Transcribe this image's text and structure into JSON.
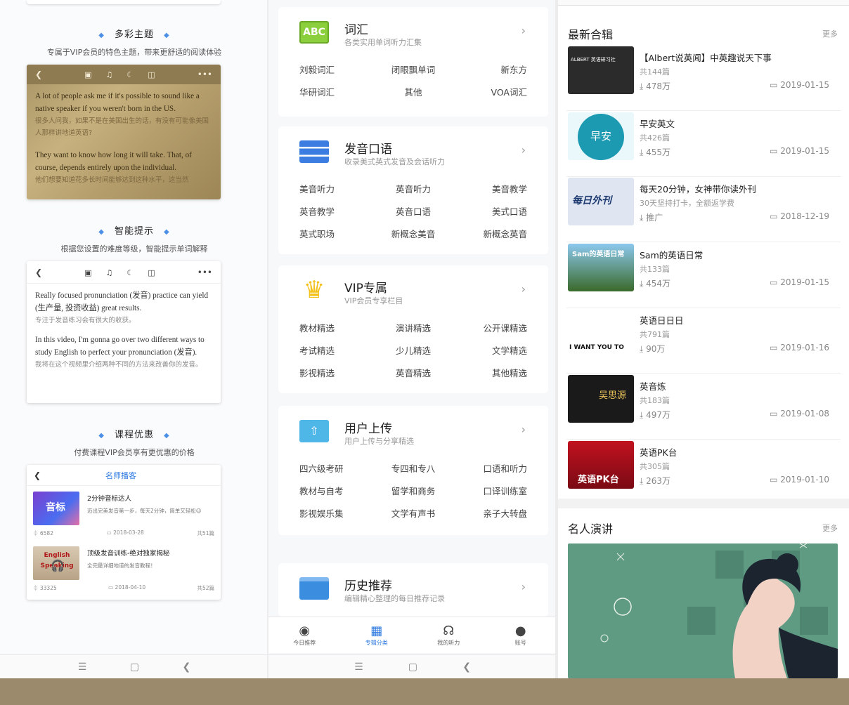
{
  "panel1": {
    "sections": [
      {
        "title": "多彩主题",
        "subtitle": "专属于VIP会员的特色主题，带来更舒适的阅读体验"
      },
      {
        "title": "智能提示",
        "subtitle": "根据您设置的难度等级，智能提示单词解释"
      },
      {
        "title": "课程优惠",
        "subtitle": "付费课程VIP会员享有更优惠的价格"
      }
    ],
    "theme_reader": {
      "p1_en": "A lot of people ask me if it's possible to sound like a native speaker if you weren't born in the US.",
      "p1_zh": "很多人问我，如果不是在美国出生的话，有没有可能像美国人那样讲地道英语?",
      "p2_en": "They want to know how long it will take. That, of course, depends entirely upon the individual.",
      "p2_zh": "他们想要知道花多长时间能够达到这种水平，这当然"
    },
    "hint_reader": {
      "p1_en": "Really focused pronunciation (发音) practice can yield (生产量, 投资收益) great results.",
      "p1_zh": "专注于发音练习会有很大的收获。",
      "p2_en": "In this video, I'm gonna go over two different ways to study English to perfect your pronunciation (发音).",
      "p2_zh": "我将在这个视频里介绍两种不同的方法来改善你的发音。"
    },
    "course_card": {
      "title": "名师播客",
      "items": [
        {
          "title": "2分钟音标达人",
          "desc": "迈出完美发音第一步，每天2分钟，简单又轻松😉",
          "thumb_text": "音标",
          "plays": "6582",
          "date": "2018-03-28",
          "count": "共51篇"
        },
        {
          "title": "顶级发音训练-绝对独家揭秘",
          "desc": "全完最详细地道的发音教程！",
          "thumb_text": "English Speaking",
          "plays": "33325",
          "date": "2018-04-10",
          "count": "共52篇"
        }
      ]
    }
  },
  "panel2": {
    "categories": [
      {
        "name": "词汇",
        "desc": "各类实用单词听力汇集",
        "icon": "abc-icon",
        "items": [
          "刘毅词汇",
          "闭眼飘单词",
          "新东方",
          "华研词汇",
          "其他",
          "VOA词汇"
        ]
      },
      {
        "name": "发音口语",
        "desc": "收录美式英式发音及会话听力",
        "icon": "server-icon",
        "items": [
          "美音听力",
          "英音听力",
          "美音教学",
          "英音教学",
          "英音口语",
          "美式口语",
          "英式职场",
          "新概念美音",
          "新概念英音"
        ]
      },
      {
        "name": "VIP专属",
        "desc": "VIP会员专享栏目",
        "icon": "crown-icon",
        "items": [
          "教材精选",
          "演讲精选",
          "公开课精选",
          "考试精选",
          "少儿精选",
          "文学精选",
          "影视精选",
          "英音精选",
          "其他精选"
        ]
      },
      {
        "name": "用户上传",
        "desc": "用户上传与分享精选",
        "icon": "folder-upload-icon",
        "items": [
          "四六级考研",
          "专四和专八",
          "口语和听力",
          "教材与自考",
          "留学和商务",
          "口译训练室",
          "影视娱乐集",
          "文学有声书",
          "亲子大转盘"
        ]
      },
      {
        "name": "历史推荐",
        "desc": "编辑精心整理的每日推荐记录",
        "icon": "history-icon",
        "items": []
      }
    ],
    "tabs": [
      {
        "label": "今日推荐",
        "icon": "globe-icon"
      },
      {
        "label": "专辑分类",
        "icon": "grid-icon"
      },
      {
        "label": "我的听力",
        "icon": "headphones-icon"
      },
      {
        "label": "账号",
        "icon": "person-icon"
      }
    ]
  },
  "panel3": {
    "section1_title": "最新合辑",
    "section2_title": "名人演讲",
    "more_label": "更多",
    "albums": [
      {
        "title": "【Albert说英闻】中英趣说天下事",
        "sub": "共144篇",
        "dl": "478万",
        "date": "2019-01-15",
        "cover_text": "ALBERT 英语研习社"
      },
      {
        "title": "早安英文",
        "sub": "共426篇",
        "dl": "455万",
        "date": "2019-01-15",
        "cover_text": "早安"
      },
      {
        "title": "每天20分钟，女神带你读外刊",
        "sub": "30天坚持打卡，全额返学费",
        "dl": "推广",
        "date": "2018-12-19",
        "cover_text": "每日外刊"
      },
      {
        "title": "Sam的英语日常",
        "sub": "共133篇",
        "dl": "454万",
        "date": "2019-01-15",
        "cover_text": "Sam的英语日常"
      },
      {
        "title": "英语日日日",
        "sub": "共791篇",
        "dl": "90万",
        "date": "2019-01-16",
        "cover_text": "I WANT YOU TO"
      },
      {
        "title": "英音炼",
        "sub": "共183篇",
        "dl": "497万",
        "date": "2019-01-08",
        "cover_text": "吴思源"
      },
      {
        "title": "英语PK台",
        "sub": "共305篇",
        "dl": "263万",
        "date": "2019-01-10",
        "cover_text": "英语PK台"
      }
    ]
  }
}
